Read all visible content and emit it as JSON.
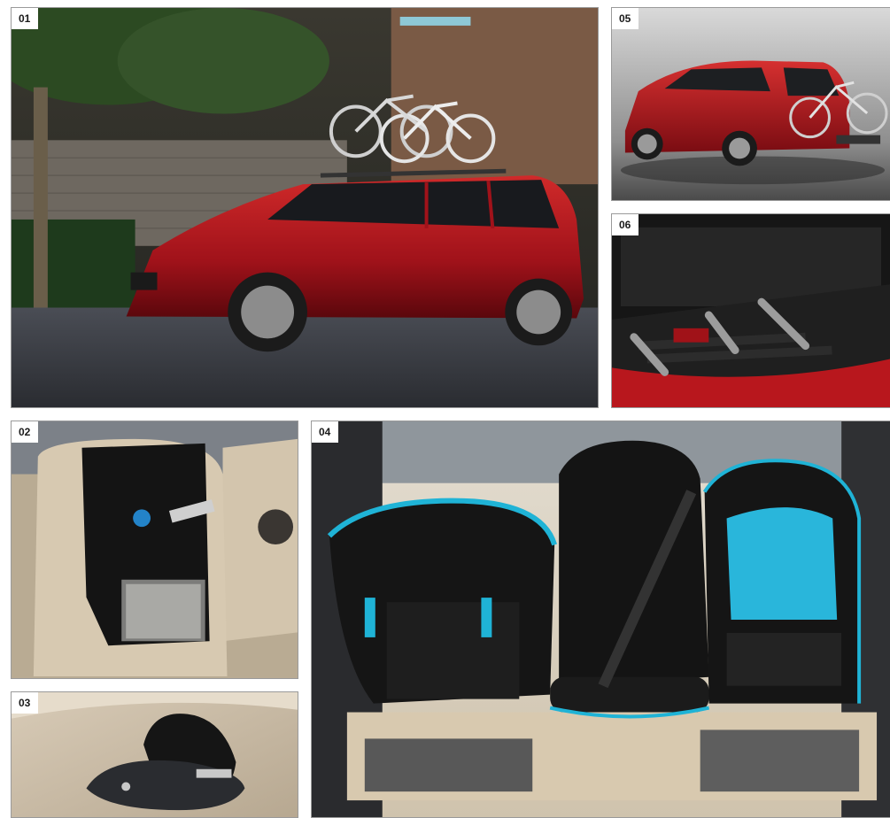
{
  "panels": [
    {
      "label": "01",
      "subject": "red-minivan-with-roof-bike-rack"
    },
    {
      "label": "02",
      "subject": "seat-back-organizer"
    },
    {
      "label": "03",
      "subject": "key-fob-case"
    },
    {
      "label": "04",
      "subject": "child-seats-on-rear-bench"
    },
    {
      "label": "05",
      "subject": "red-minivan-with-rear-bike-carrier"
    },
    {
      "label": "06",
      "subject": "folded-bike-carrier-in-trunk"
    }
  ],
  "colors": {
    "car_red": "#b0161c",
    "accent_cyan": "#1fb3d6",
    "seat_beige": "#d9cbb4",
    "frame_border": "#9a9a9a"
  }
}
